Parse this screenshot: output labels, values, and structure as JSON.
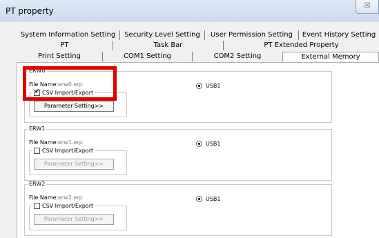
{
  "window": {
    "title": "PT property",
    "close_glyph": "☒"
  },
  "tabs": {
    "row1": [
      {
        "label": "System Information Setting"
      },
      {
        "label": "Security Level Setting"
      },
      {
        "label": "User Permission Setting"
      },
      {
        "label": "Event History Setting"
      }
    ],
    "row2": [
      {
        "label": "PT"
      },
      {
        "label": "Task Bar"
      },
      {
        "label": "PT Extended Property"
      }
    ],
    "row3": [
      {
        "label": "Print Setting"
      },
      {
        "label": "COM1 Setting"
      },
      {
        "label": "COM2 Setting"
      },
      {
        "label": "External Memory",
        "active": true
      }
    ]
  },
  "groups": [
    {
      "legend": "ERW0",
      "file_label": "File Name:",
      "file_value": "erw0.erp",
      "csv_label": "CSV Import/Export",
      "csv_checked": true,
      "check_mark": "✔",
      "param_label": "Parameter Setting>>",
      "param_enabled": true,
      "radio_label": "USB1",
      "radio_selected": true
    },
    {
      "legend": "ERW1",
      "file_label": "File Name:",
      "file_value": "erw1.erp",
      "csv_label": "CSV Import/Export",
      "csv_checked": false,
      "check_mark": "",
      "param_label": "Parameter Setting>>",
      "param_enabled": false,
      "radio_label": "USB1",
      "radio_selected": true
    },
    {
      "legend": "ERW2",
      "file_label": "File Name:",
      "file_value": "erw2.erp",
      "csv_label": "CSV Import/Export",
      "csv_checked": false,
      "check_mark": "",
      "param_label": "Parameter Setting>>",
      "param_enabled": false,
      "radio_label": "USB1",
      "radio_selected": true
    }
  ],
  "colors": {
    "highlight": "#e20000",
    "accent_title": "#cbdcee"
  }
}
